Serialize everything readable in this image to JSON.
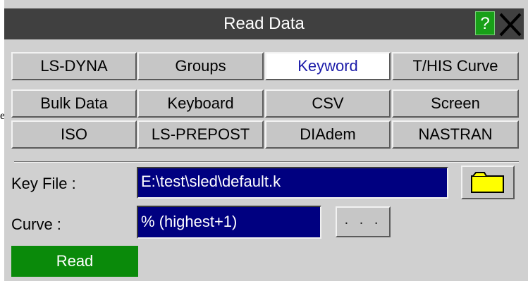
{
  "stray_char": "e",
  "window": {
    "title": "Read Data",
    "help_label": "?",
    "close_icon": "close-icon"
  },
  "tabs": [
    {
      "label": "LS-DYNA",
      "active": false
    },
    {
      "label": "Groups",
      "active": false
    },
    {
      "label": "Keyword",
      "active": true
    },
    {
      "label": "T/HIS Curve",
      "active": false
    },
    {
      "label": "Bulk Data",
      "active": false
    },
    {
      "label": "Keyboard",
      "active": false
    },
    {
      "label": "CSV",
      "active": false
    },
    {
      "label": "Screen",
      "active": false
    },
    {
      "label": "ISO",
      "active": false
    },
    {
      "label": "LS-PREPOST",
      "active": false
    },
    {
      "label": "DIAdem",
      "active": false
    },
    {
      "label": "NASTRAN",
      "active": false
    }
  ],
  "key_file": {
    "label": "Key File :",
    "value": "E:\\test\\sled\\default.k",
    "browse_icon": "folder-icon"
  },
  "curve": {
    "label": "Curve :",
    "value": "% (highest+1)",
    "more_label": ". . ."
  },
  "actions": {
    "read_label": "Read"
  },
  "colors": {
    "titlebar": "#404040",
    "panel": "#d0d0d0",
    "field": "#000080",
    "active_tab_text": "#1a1aa8",
    "read_button": "#0a8a0a",
    "help_button": "#18a018",
    "folder": "#ffff00"
  }
}
